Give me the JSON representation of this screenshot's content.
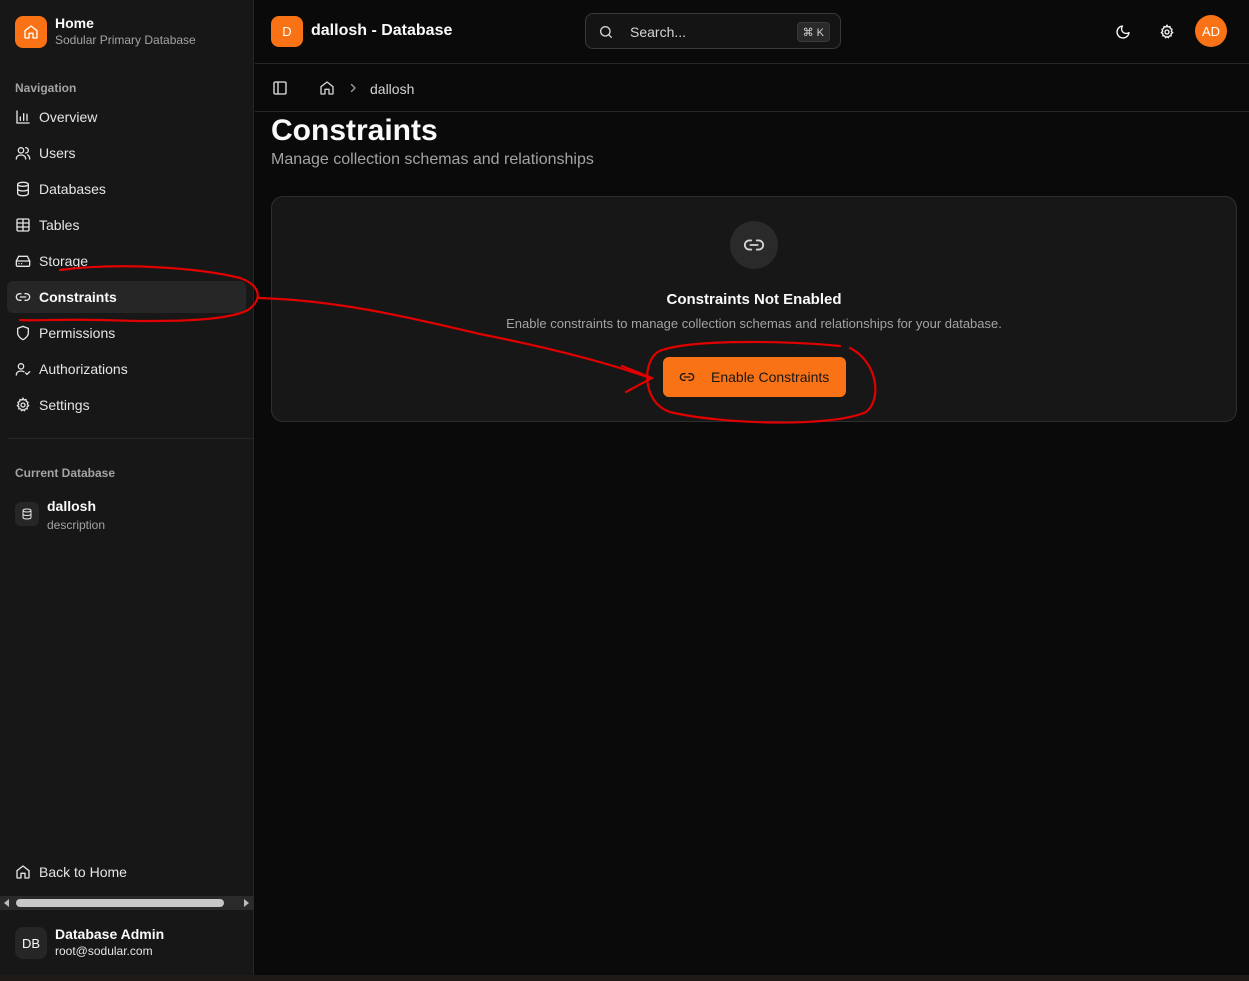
{
  "sidebar": {
    "brand": {
      "title": "Home",
      "subtitle": "Sodular Primary Database",
      "icon": "home-icon"
    },
    "nav_label": "Navigation",
    "items": [
      {
        "label": "Overview",
        "icon": "bar-chart-icon",
        "active": false
      },
      {
        "label": "Users",
        "icon": "users-icon",
        "active": false
      },
      {
        "label": "Databases",
        "icon": "database-icon",
        "active": false
      },
      {
        "label": "Tables",
        "icon": "table-icon",
        "active": false
      },
      {
        "label": "Storage",
        "icon": "hard-drive-icon",
        "active": false
      },
      {
        "label": "Constraints",
        "icon": "link-icon",
        "active": true
      },
      {
        "label": "Permissions",
        "icon": "shield-icon",
        "active": false
      },
      {
        "label": "Authorizations",
        "icon": "user-check-icon",
        "active": false
      },
      {
        "label": "Settings",
        "icon": "gear-icon",
        "active": false
      }
    ],
    "current_db_label": "Current Database",
    "current_db": {
      "name": "dallosh",
      "description": "description",
      "icon": "database-icon"
    },
    "back_home": "Back to Home",
    "user": {
      "initials": "DB",
      "name": "Database Admin",
      "email": "root@sodular.com"
    }
  },
  "header": {
    "logo_letter": "D",
    "title": "dallosh - Database",
    "search_placeholder": "Search...",
    "shortcut": "⌘ K",
    "avatar_initials": "AD",
    "icons": [
      "moon-icon",
      "gear-icon"
    ]
  },
  "breadcrumb": {
    "current": "dallosh"
  },
  "main": {
    "title": "Constraints",
    "subtitle": "Manage collection schemas and relationships",
    "card": {
      "title": "Constraints Not Enabled",
      "description": "Enable constraints to manage collection schemas and relationships for your database.",
      "button_label": "Enable Constraints"
    }
  },
  "colors": {
    "accent": "#f97316",
    "background": "#0a0a0a",
    "sidebar": "#171717",
    "annotation": "#e00000"
  }
}
